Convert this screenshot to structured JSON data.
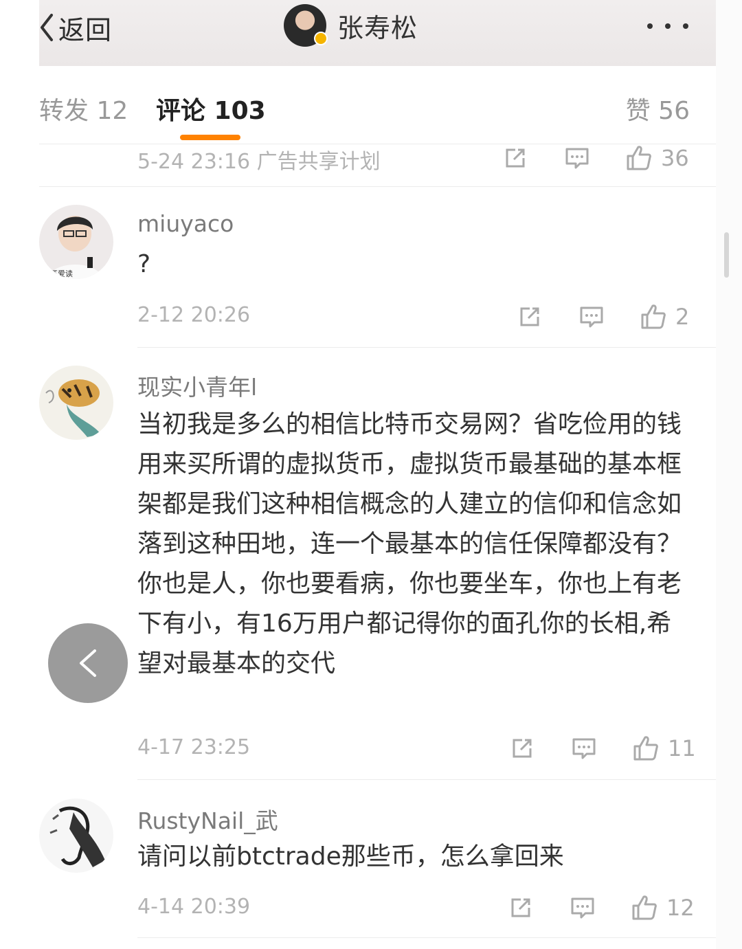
{
  "header": {
    "back_label": "返回",
    "profile_name": "张寿松"
  },
  "tabs": {
    "reposts": "转发 12",
    "comments": "评论 103",
    "likes": "赞 56"
  },
  "top_item": {
    "meta": "5-24 23:16 广告共享计划",
    "likes": "36"
  },
  "comments": [
    {
      "username": "miuyaco",
      "text": "?",
      "time": "2-12 20:26",
      "likes": "2",
      "avatar_caption": "还爱读"
    },
    {
      "username": "现实小青年l",
      "text": "当初我是多么的相信比特币交易网？省吃俭用的钱用来买所谓的虚拟货币，虚拟货币最基础的基本框架都是我们这种相信概念的人建立的信仰和信念如落到这种田地，连一个最基本的信任保障都没有？你也是人，你也要看病，你也要坐车，你也上有老下有小，有16万用户都记得你的面孔你的长相,希望对最基本的交代",
      "time": "4-17 23:25",
      "likes": "11"
    },
    {
      "username": "RustyNail_武",
      "text": "请问以前btctrade那些币，怎么拿回来",
      "time": "4-14 20:39",
      "likes": "12"
    }
  ],
  "icons": {
    "repost": "share-out-icon",
    "reply": "comment-bubble-icon",
    "like": "thumbs-up-icon",
    "back": "chevron-left-icon"
  },
  "colors": {
    "accent": "#ff8200",
    "meta_text": "#b3b3b3",
    "floating_button": "#9b9b9b"
  }
}
